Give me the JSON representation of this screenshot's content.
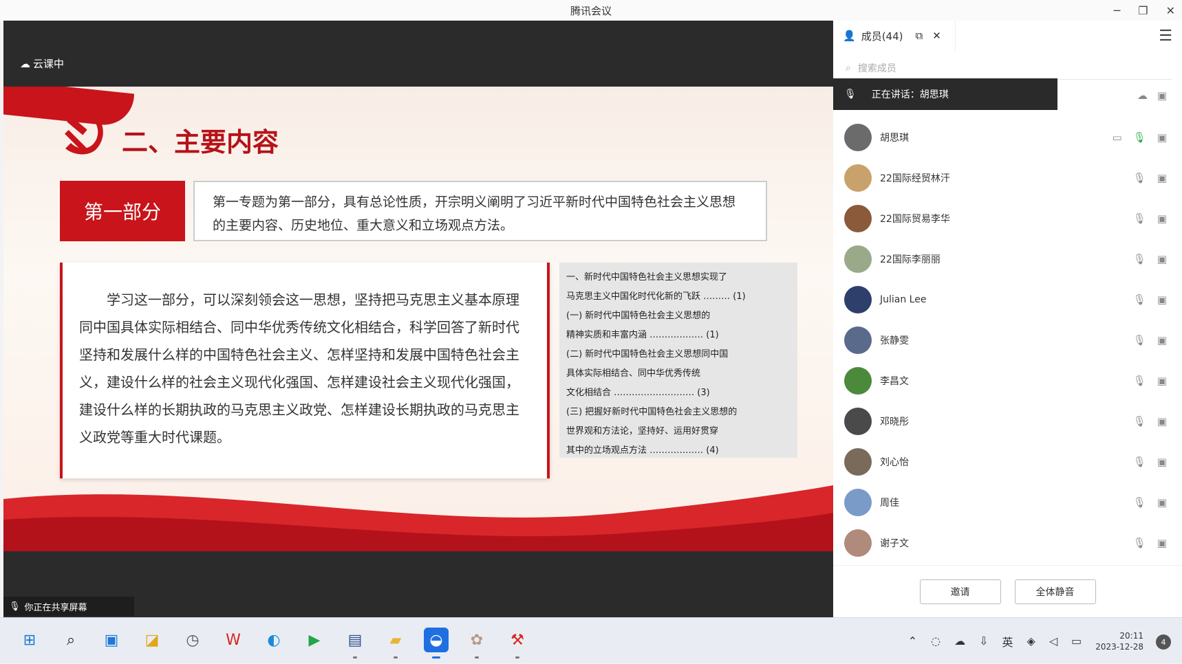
{
  "window": {
    "title": "腾讯会议",
    "controls": [
      "─",
      "❐",
      "✕"
    ]
  },
  "stage": {
    "logo_text": "云课中",
    "share_label": "你正在共享屏幕"
  },
  "slide": {
    "title": "二、主要内容",
    "part_label": "第一部分",
    "part_description": "第一专题为第一部分，具有总论性质，开宗明义阐明了习近平新时代中国特色社会主义思想的主要内容、历史地位、重大意义和立场观点方法。",
    "main_text": "学习这一部分，可以深刻领会这一思想，坚持把马克思主义基本原理同中国具体实际相结合、同中华优秀传统文化相结合，科学回答了新时代坚持和发展什么样的中国特色社会主义、怎样坚持和发展中国特色社会主义，建设什么样的社会主义现代化强国、怎样建设社会主义现代化强国，建设什么样的长期执政的马克思主义政党、怎样建设长期执政的马克思主义政党等重大时代课题。",
    "toc": [
      "一、新时代中国特色社会主义思想实现了",
      "马克思主义中国化时代化新的飞跃 ……… (1)",
      "(一) 新时代中国特色社会主义思想的",
      "精神实质和丰富内涵 ……………… (1)",
      "(二) 新时代中国特色社会主义思想同中国",
      "具体实际相结合、同中华优秀传统",
      "文化相结合 ……………………… (3)",
      "(三) 把握好新时代中国特色社会主义思想的",
      "世界观和方法论，坚持好、运用好贯穿",
      "其中的立场观点方法 ……………… (4)"
    ]
  },
  "panel": {
    "tab_label": "成员(44)",
    "search_placeholder": "搜索成员",
    "speaking_label": "正在讲话：胡思琪",
    "participants": [
      {
        "name": "胡思琪",
        "color": "#6b6b6b"
      },
      {
        "name": "22国际经贸林汗",
        "color": "#c9a16a"
      },
      {
        "name": "22国际贸易李华",
        "color": "#8a5a3a"
      },
      {
        "name": "22国际李丽丽",
        "color": "#9aa98a"
      },
      {
        "name": "Julian Lee",
        "color": "#2e3f6b"
      },
      {
        "name": "张静雯",
        "color": "#5a6a8a"
      },
      {
        "name": "李昌文",
        "color": "#4a8a3a"
      },
      {
        "name": "邓晓彤",
        "color": "#4a4a4a"
      },
      {
        "name": "刘心怡",
        "color": "#7a6a5a"
      },
      {
        "name": "周佳",
        "color": "#7a9ac8"
      },
      {
        "name": "谢子文",
        "color": "#b08a7a"
      }
    ],
    "btn_invite": "邀请",
    "btn_mute_all": "全体静音"
  },
  "taskbar": {
    "apps": [
      "windows-start",
      "search",
      "desktop",
      "notes",
      "clock-app",
      "wps",
      "edge",
      "player",
      "monitor",
      "file-explorer",
      "tencent-meeting",
      "pinwheel",
      "tools"
    ],
    "ime": "英",
    "time": "20:11",
    "date": "2023-12-28",
    "notification_count": "4"
  }
}
